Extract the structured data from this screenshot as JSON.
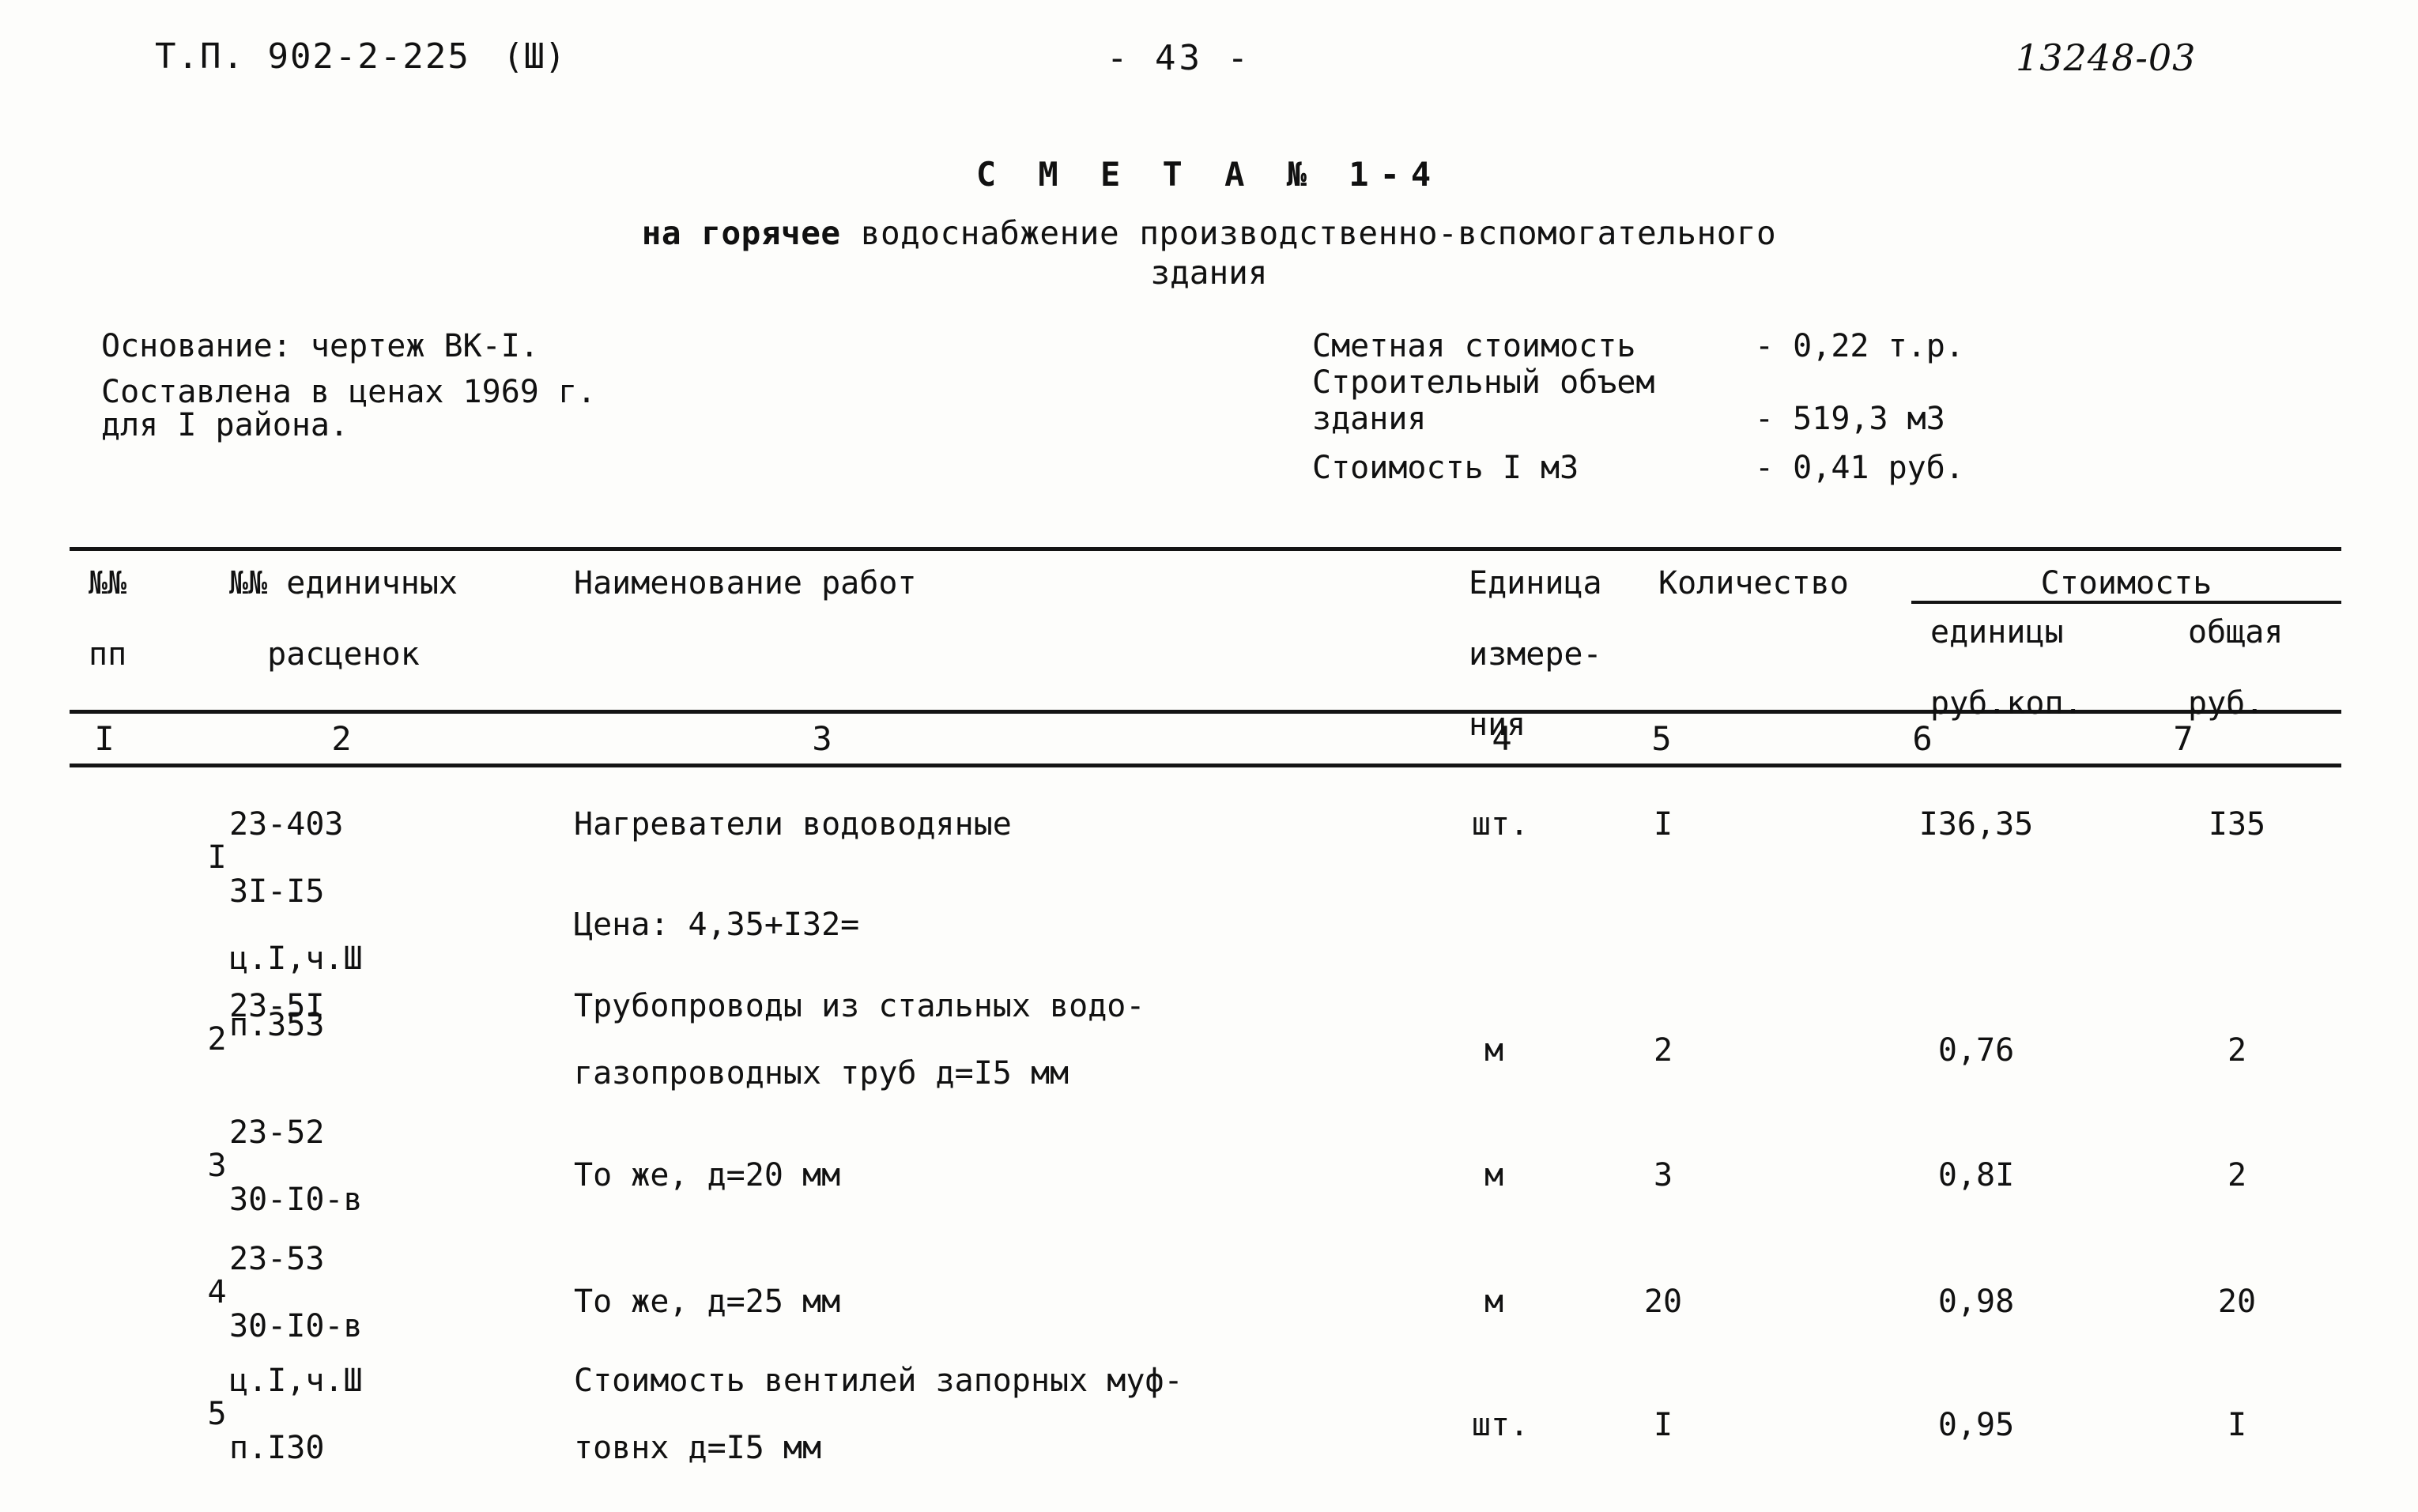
{
  "header": {
    "doc_code": "Т.П. 902-2-225",
    "doc_series": "(Ш)",
    "page_number": "- 43 -",
    "archive_number": "13248-03"
  },
  "title": {
    "smeta_label": "С М Е Т А  № 1-4",
    "subtitle_bold": "на горячее",
    "subtitle_rest": " водоснабжение производственно-вспомогательного",
    "subtitle_line2": "здания"
  },
  "meta_left": {
    "basis": "Основание: чертеж ВК-I.",
    "prices_line1": "Составлена в ценах 1969 г.",
    "prices_line2": "для I района."
  },
  "meta_right": {
    "rows": [
      {
        "label": "Сметная стоимость",
        "value": "- 0,22 т.р."
      },
      {
        "label": "Строительный объем",
        "value": ""
      },
      {
        "label": "здания",
        "value": "- 519,3 м3"
      },
      {
        "label": "Стоимость I м3",
        "value": "- 0,41  руб."
      }
    ]
  },
  "table": {
    "headers": {
      "col1_l1": "№№",
      "col1_l2": "пп",
      "col2_l1": "№№ единичных",
      "col2_l2": "  расценок",
      "col3": "Наименование работ",
      "col4_l1": "Единица",
      "col4_l2": "измере-",
      "col4_l3": "ния",
      "col5": "Количество",
      "col67_group": "Стоимость",
      "col6_l1": "единицы",
      "col6_l2": "руб.коп.",
      "col7_l1": "общая",
      "col7_l2": "руб."
    },
    "column_numbers": [
      "I",
      "2",
      "3",
      "4",
      "5",
      "6",
      "7"
    ],
    "rows": [
      {
        "no": "I",
        "codes": [
          "23-403",
          "3I-I5",
          "ц.I,ч.Ш",
          "п.353"
        ],
        "work": [
          "Нагреватели водоводяные",
          "",
          "Цена: 4,35+I32="
        ],
        "unit": "шт.",
        "qty": "I",
        "price_unit": "I36,35",
        "price_total": "I35"
      },
      {
        "no": "2",
        "codes": [
          "23-5I"
        ],
        "work": [
          "Трубопроводы из стальных водо-",
          "газопроводных труб д=I5 мм"
        ],
        "unit": "м",
        "qty": "2",
        "price_unit": "0,76",
        "price_total": "2"
      },
      {
        "no": "3",
        "codes": [
          "23-52",
          "30-I0-в"
        ],
        "work": [
          "То же, д=20 мм"
        ],
        "unit": "м",
        "qty": "3",
        "price_unit": "0,8I",
        "price_total": "2"
      },
      {
        "no": "4",
        "codes": [
          "23-53",
          "30-I0-в"
        ],
        "work": [
          "То же, д=25 мм"
        ],
        "unit": "м",
        "qty": "20",
        "price_unit": "0,98",
        "price_total": "20"
      },
      {
        "no": "5",
        "codes": [
          "ц.I,ч.Ш",
          "п.I30"
        ],
        "work": [
          "Стоимость вентилей запорных муф-",
          "товнх д=I5 мм"
        ],
        "unit": "шт.",
        "qty": "I",
        "price_unit": "0,95",
        "price_total": "I"
      }
    ]
  }
}
